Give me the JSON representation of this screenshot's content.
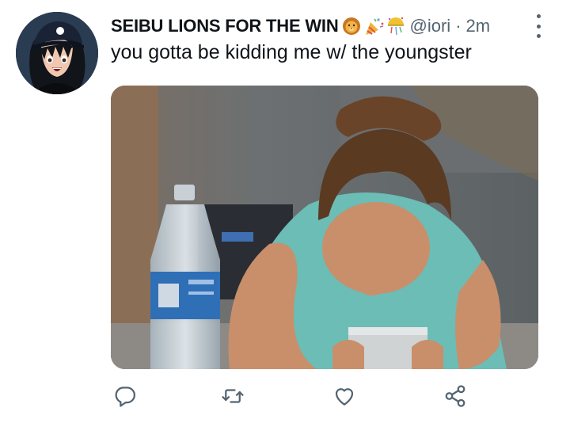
{
  "tweet": {
    "display_name": "SEIBU LIONS FOR THE WIN",
    "name_emojis": [
      "lion-face-emoji",
      "party-popper-emoji",
      "confetti-ball-emoji"
    ],
    "handle": "@iori",
    "separator": "·",
    "time": "2m",
    "text": "you gotta be kidding me w/ the youngster"
  },
  "media": {
    "type": "gif"
  },
  "actions": [
    {
      "name": "reply",
      "icon": "reply-icon"
    },
    {
      "name": "retweet",
      "icon": "retweet-icon"
    },
    {
      "name": "like",
      "icon": "heart-icon"
    },
    {
      "name": "share",
      "icon": "share-icon"
    }
  ],
  "colors": {
    "text": "#0f1419",
    "secondary": "#536471",
    "icon": "#536471"
  }
}
